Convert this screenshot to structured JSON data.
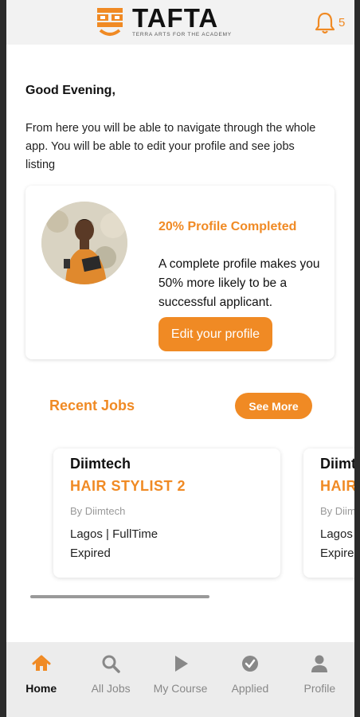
{
  "header": {
    "logo_title": "TAFTA",
    "logo_subtitle": "TERRA ARTS FOR THE ACADEMY",
    "notification_count": "5"
  },
  "greeting": "Good Evening,",
  "intro": "From here you will be able to navigate through the whole app. You will be able to edit your profile and see jobs listing",
  "profile_card": {
    "progress_label": "20%  Profile Completed",
    "progress_value": 0.2,
    "message": "A complete profile makes you 50% more likely to be a successful applicant.",
    "edit_button": "Edit your profile"
  },
  "recent_jobs": {
    "title": "Recent Jobs",
    "see_more": "See More",
    "jobs": [
      {
        "company": "Diimtech",
        "title": "HAIR STYLIST 2",
        "by": "By Diimtech",
        "location": "Lagos | FullTime",
        "status": "Expired"
      },
      {
        "company": "Diimtech",
        "title": "HAIR STYLIST",
        "by": "By Diimtech",
        "location": "Lagos | FullTime",
        "status": "Expired"
      }
    ]
  },
  "bottom_nav": {
    "items": [
      {
        "label": "Home",
        "icon": "home-icon",
        "active": true
      },
      {
        "label": "All Jobs",
        "icon": "search-icon",
        "active": false
      },
      {
        "label": "My Course",
        "icon": "play-icon",
        "active": false
      },
      {
        "label": "Applied",
        "icon": "check-circle-icon",
        "active": false
      },
      {
        "label": "Profile",
        "icon": "person-icon",
        "active": false
      }
    ]
  },
  "colors": {
    "accent": "#f08a24",
    "nav_inactive": "#888888",
    "header_bg": "#f2f2f2"
  }
}
